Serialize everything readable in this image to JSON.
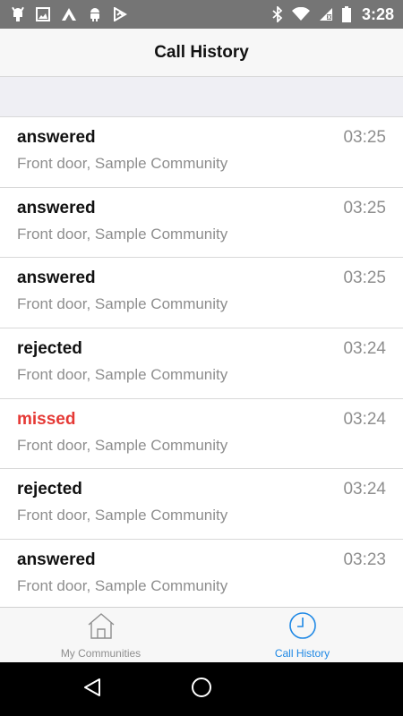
{
  "status_bar": {
    "time": "3:28",
    "left_icons": [
      "android-debug-icon",
      "image-icon",
      "app-icon",
      "android-icon",
      "play-store-icon"
    ],
    "right_icons": [
      "bluetooth-icon",
      "wifi-icon",
      "no-sim-icon",
      "battery-icon"
    ]
  },
  "header": {
    "title": "Call History"
  },
  "calls": [
    {
      "status": "answered",
      "location": "Front door, Sample Community",
      "time": "03:25"
    },
    {
      "status": "answered",
      "location": "Front door, Sample Community",
      "time": "03:25"
    },
    {
      "status": "answered",
      "location": "Front door, Sample Community",
      "time": "03:25"
    },
    {
      "status": "rejected",
      "location": "Front door, Sample Community",
      "time": "03:24"
    },
    {
      "status": "missed",
      "location": "Front door, Sample Community",
      "time": "03:24"
    },
    {
      "status": "rejected",
      "location": "Front door, Sample Community",
      "time": "03:24"
    },
    {
      "status": "answered",
      "location": "Front door, Sample Community",
      "time": "03:23"
    }
  ],
  "tabs": [
    {
      "label": "My Communities",
      "icon": "home-icon",
      "active": false
    },
    {
      "label": "Call History",
      "icon": "clock-icon",
      "active": true
    }
  ],
  "colors": {
    "status_bar": "#757575",
    "accent": "#1e88e5",
    "missed": "#e53935",
    "secondary_text": "#8e8e8e"
  },
  "nav_bar": {
    "buttons": [
      "back-icon",
      "home-circle-icon"
    ]
  }
}
